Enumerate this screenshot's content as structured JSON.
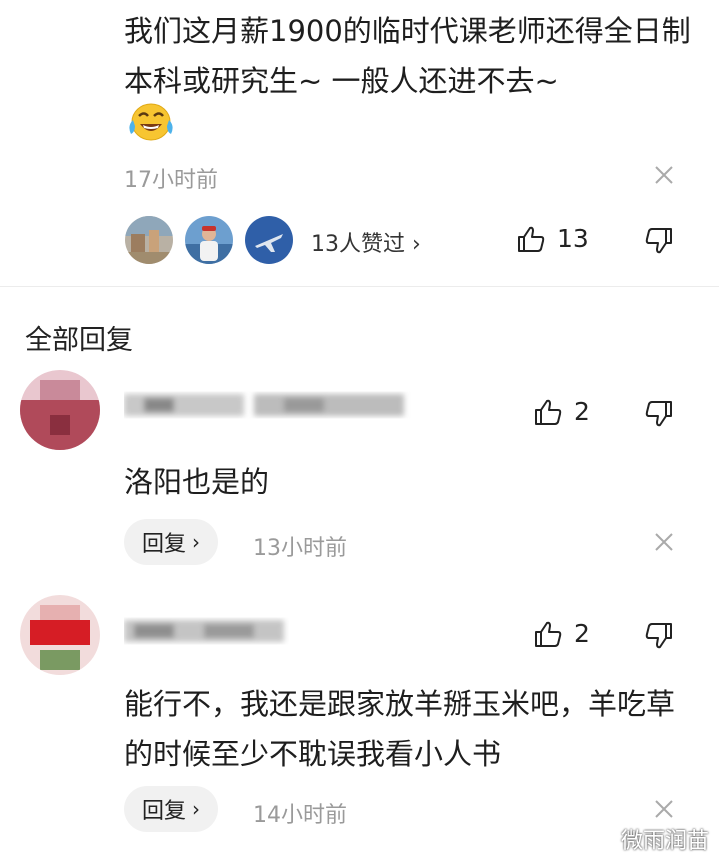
{
  "top_comment": {
    "text": "我们这月薪1900的临时代课老师还得全日制本科或研究生~ 一般人还进不去~",
    "emoji": "laughing-crying-face-icon",
    "time": "17小时前",
    "likers_text": "13人赞过 ›",
    "like_count": "13"
  },
  "section_title": "全部回复",
  "replies": [
    {
      "text": "洛阳也是的",
      "like_count": "2",
      "reply_label": "回复",
      "time": "13小时前"
    },
    {
      "text": "能行不，我还是跟家放羊掰玉米吧，羊吃草的时候至少不耽误我看小人书",
      "like_count": "2",
      "reply_label": "回复",
      "time": "14小时前"
    }
  ],
  "watermark": "微雨润苗",
  "colors": {
    "muted": "#9a9a9a",
    "text": "#1e1e1e",
    "button_bg": "#f1f1f1"
  }
}
